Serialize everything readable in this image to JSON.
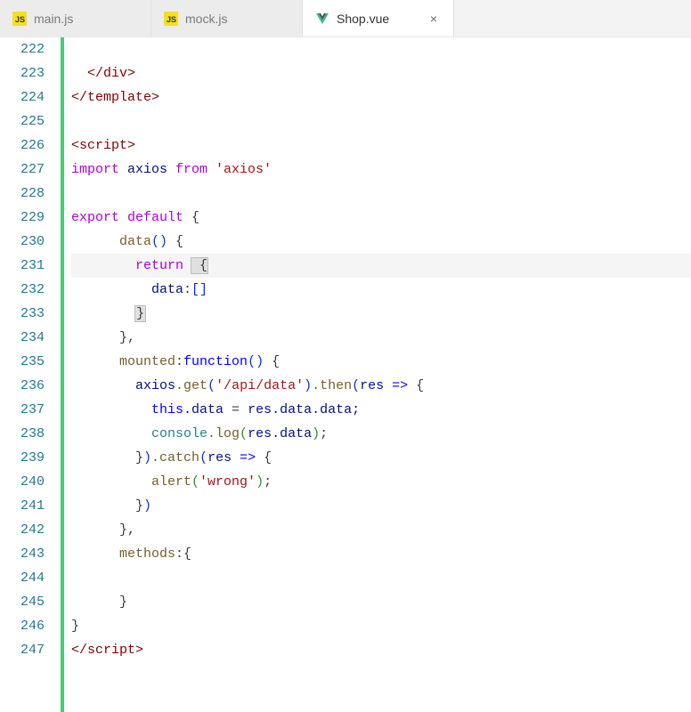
{
  "tabs": [
    {
      "label": "main.js",
      "icon": "js-icon",
      "active": false
    },
    {
      "label": "mock.js",
      "icon": "js-icon",
      "active": false
    },
    {
      "label": "Shop.vue",
      "icon": "vue-icon",
      "active": true,
      "closable": true
    }
  ],
  "close_glyph": "×",
  "lines": {
    "start": 222,
    "end": 247
  },
  "code": {
    "l222": "",
    "l223_open": "</",
    "l223_tag": "div",
    "l223_close": ">",
    "l224_open": "</",
    "l224_tag": "template",
    "l224_close": ">",
    "l225": "",
    "l226_open": "<",
    "l226_tag": "script",
    "l226_close": ">",
    "l227_import": "import",
    "l227_axios": " axios ",
    "l227_from": "from",
    "l227_str": " 'axios'",
    "l228": "",
    "l229_export": "export",
    "l229_default": " default",
    "l229_brace": " {",
    "l230_data": "data",
    "l230_paren": "()",
    "l230_brace": " {",
    "l231_return": "return",
    "l231_brace": " {",
    "l232_data": "data",
    "l232_colon": ":",
    "l232_arr": "[]",
    "l233_brace": "}",
    "l234_brace": "},",
    "l235_mounted": "mounted",
    "l235_colon": ":",
    "l235_function": "function",
    "l235_paren": "()",
    "l235_brace": " {",
    "l236_axios": "axios",
    "l236_get": ".get",
    "l236_p1": "(",
    "l236_str": "'/api/data'",
    "l236_p2": ")",
    "l236_then": ".then",
    "l236_p3": "(",
    "l236_res": "res",
    "l236_arrow": " => ",
    "l236_brace": "{",
    "l237_this": "this",
    "l237_data1": ".data",
    "l237_eq": " = ",
    "l237_res": "res",
    "l237_data2": ".data.data;",
    "l238_console": "console",
    "l238_log": ".log",
    "l238_p1": "(",
    "l238_res": "res",
    "l238_data": ".data",
    "l238_p2": ")",
    "l238_semi": ";",
    "l239_brace": "}",
    "l239_p1": ")",
    "l239_catch": ".catch",
    "l239_p2": "(",
    "l239_res": "res",
    "l239_arrow": " => ",
    "l239_brace2": "{",
    "l240_alert": "alert",
    "l240_p1": "(",
    "l240_str": "'wrong'",
    "l240_p2": ")",
    "l240_semi": ";",
    "l241_brace": "}",
    "l241_p": ")",
    "l242_brace": "},",
    "l243_methods": "methods",
    "l243_colon": ":",
    "l243_brace": "{",
    "l244": "",
    "l245_brace": "}",
    "l246_brace": "}",
    "l247_open": "</",
    "l247_tag": "script",
    "l247_close": ">"
  }
}
